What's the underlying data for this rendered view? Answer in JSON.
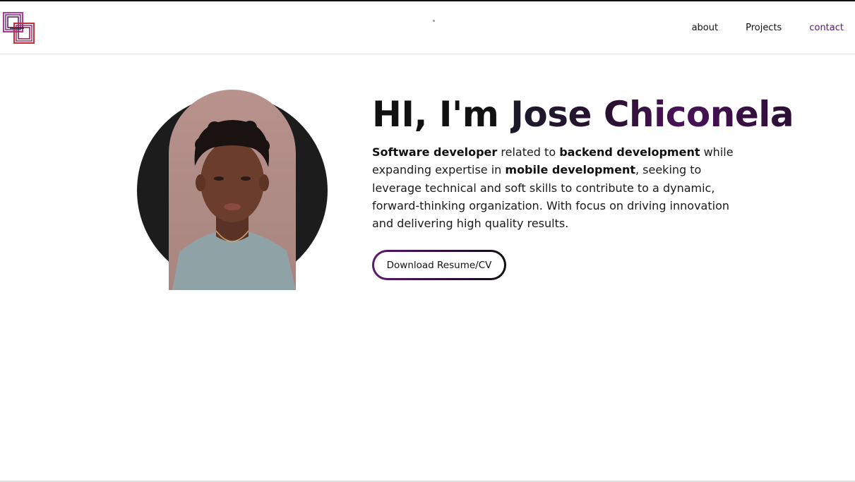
{
  "header": {
    "nav": [
      {
        "label": "about"
      },
      {
        "label": "Projects"
      },
      {
        "label": "contact"
      }
    ]
  },
  "hero": {
    "greeting": "HI, I'm ",
    "name": "Jose Chiconela",
    "bio": {
      "p1_bold": "Software developer",
      "p2": " related to ",
      "p3_bold": "backend development",
      "p4": " while expanding expertise in ",
      "p5_bold": "mobile development",
      "p6": ", seeking to leverage technical and soft skills to contribute to a dynamic, forward-thinking organization. With focus on driving innovation and delivering high quality results."
    },
    "cv_button": "Download Resume/CV"
  },
  "colors": {
    "accent": "#5a1a6e",
    "portrait_bg": "#1c1c1c",
    "text": "#111111"
  },
  "icons": {
    "logo": "overlapping-squares-logo"
  }
}
